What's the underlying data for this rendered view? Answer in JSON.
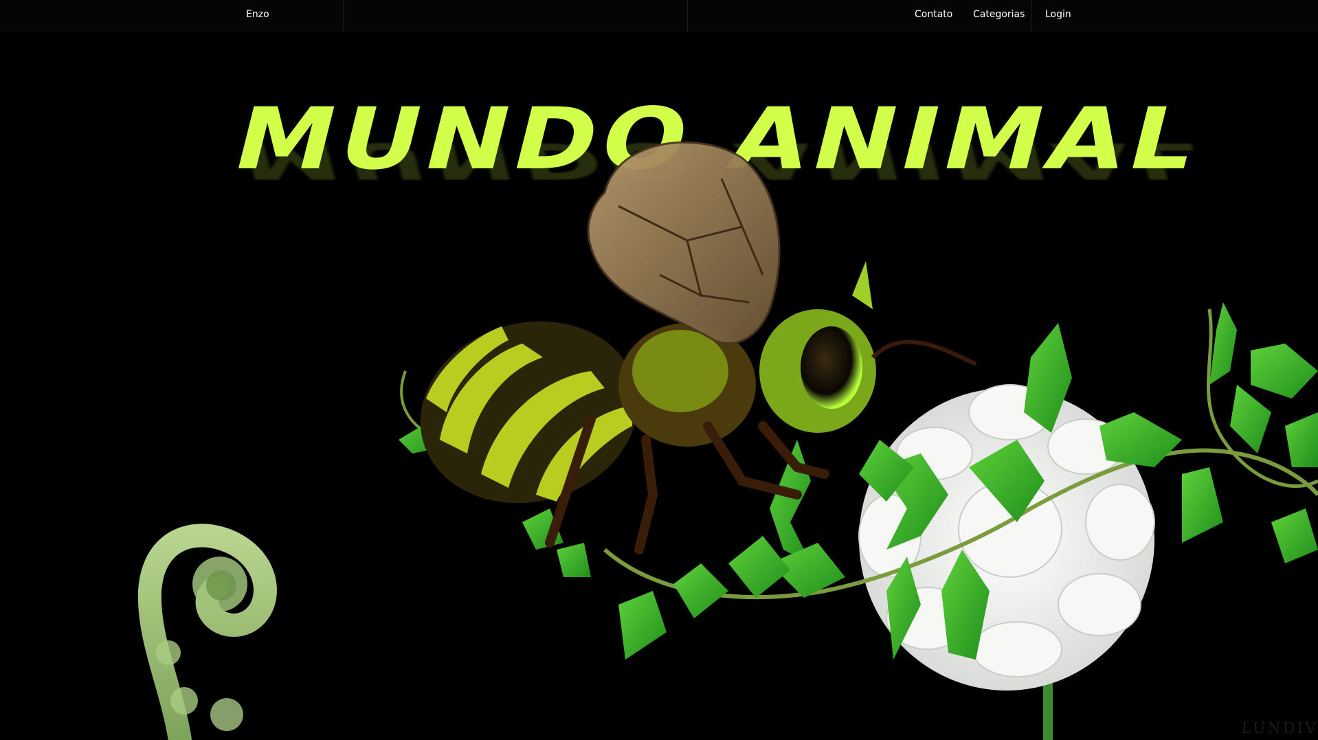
{
  "nav": {
    "brand": "Enzo",
    "links": [
      "Contato",
      "Categorias",
      "Login"
    ]
  },
  "hero": {
    "title": "MUNDO ANIMAL"
  },
  "footer": {
    "watermark": "LUNDIV"
  },
  "colors": {
    "background": "#000000",
    "title_accent": "#d1ff4a",
    "nav_text": "#ffffff"
  },
  "icons": {
    "bee": "bee-illustration",
    "flower": "white-dahlia-flower",
    "fern": "fern-fiddlehead",
    "vines": "green-ivy-vines"
  }
}
